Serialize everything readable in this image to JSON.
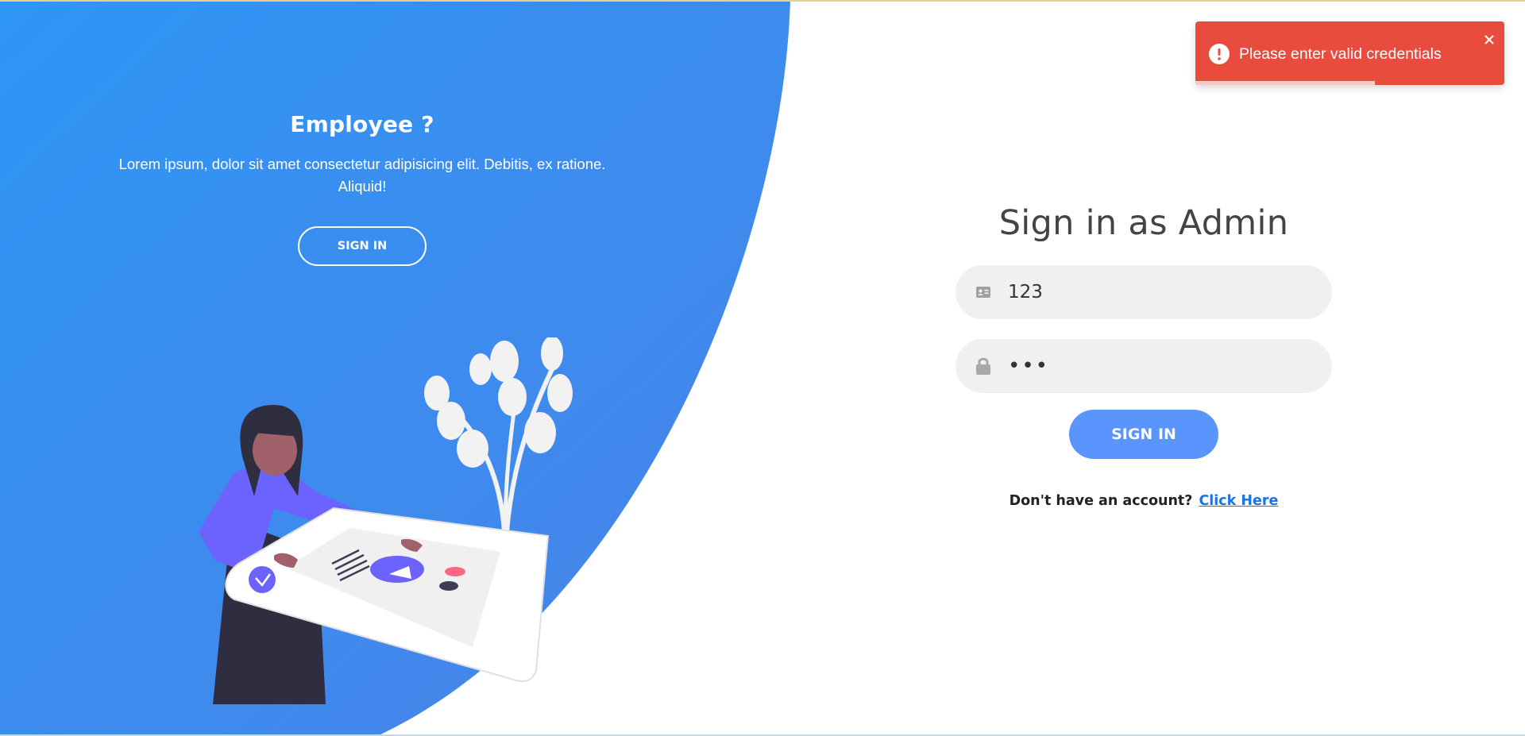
{
  "colors": {
    "panel_gradient_start": "#2e96f5",
    "panel_gradient_end": "#4a82e8",
    "accent": "#5995fd",
    "toast": "#e74c3c",
    "link": "#1a73e8"
  },
  "left_panel": {
    "title": "Employee ?",
    "text": "Lorem ipsum, dolor sit amet consectetur adipisicing elit. Debitis, ex ratione. Aliquid!",
    "button_label": "SIGN IN"
  },
  "form": {
    "title": "Sign in as Admin",
    "id_field": {
      "icon": "id-card-icon",
      "value": "123"
    },
    "password_field": {
      "icon": "lock-icon",
      "value": "•••"
    },
    "submit_label": "SIGN IN",
    "signup_prompt": "Don't have an account?",
    "signup_link": "Click Here"
  },
  "toast": {
    "icon": "error-icon",
    "message": "Please enter valid credentials",
    "close_icon": "close-icon",
    "progress": 0.58
  }
}
